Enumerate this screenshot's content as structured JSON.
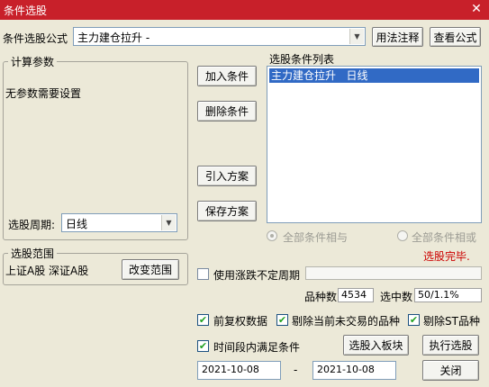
{
  "window": {
    "title": "条件选股",
    "close_glyph": "✕"
  },
  "formula": {
    "label": "条件选股公式",
    "value": "主力建仓拉升 -",
    "usage_button": "用法注释",
    "view_button": "查看公式"
  },
  "params_group": {
    "title": "计算参数",
    "no_params_text": "无参数需要设置",
    "period_label": "选股周期:",
    "period_value": "日线"
  },
  "buttons": {
    "add": "加入条件",
    "delete": "删除条件",
    "import": "引入方案",
    "save": "保存方案",
    "change_range": "改变范围",
    "to_block": "选股入板块",
    "execute": "执行选股",
    "close": "关闭"
  },
  "conditions_list": {
    "label": "选股条件列表",
    "items": [
      "主力建仓拉升   日线"
    ]
  },
  "logic": {
    "all_and": "全部条件相与",
    "all_or": "全部条件相或"
  },
  "status": {
    "done_text": "选股完毕.",
    "done_color": "#cc0000"
  },
  "range_group": {
    "title": "选股范围",
    "markets": "上证A股  深证A股"
  },
  "options": {
    "irregular_period": "使用涨跌不定周期",
    "forward_adjusted": "前复权数据",
    "exclude_untraded": "剔除当前未交易的品种",
    "exclude_st": "剔除ST品种",
    "time_range": "时间段内满足条件"
  },
  "stats": {
    "count_label": "品种数",
    "count_value": "4534",
    "selected_label": "选中数",
    "selected_value": "50/1.1%"
  },
  "dates": {
    "start": "2021-10-08",
    "separator": "-",
    "end": "2021-10-08"
  },
  "checked": {
    "irregular_period": false,
    "forward_adjusted": true,
    "exclude_untraded": true,
    "exclude_st": true,
    "time_range": true
  },
  "colors": {
    "title_bar": "#c8202a",
    "selection": "#316ac5",
    "check": "#21a121"
  }
}
